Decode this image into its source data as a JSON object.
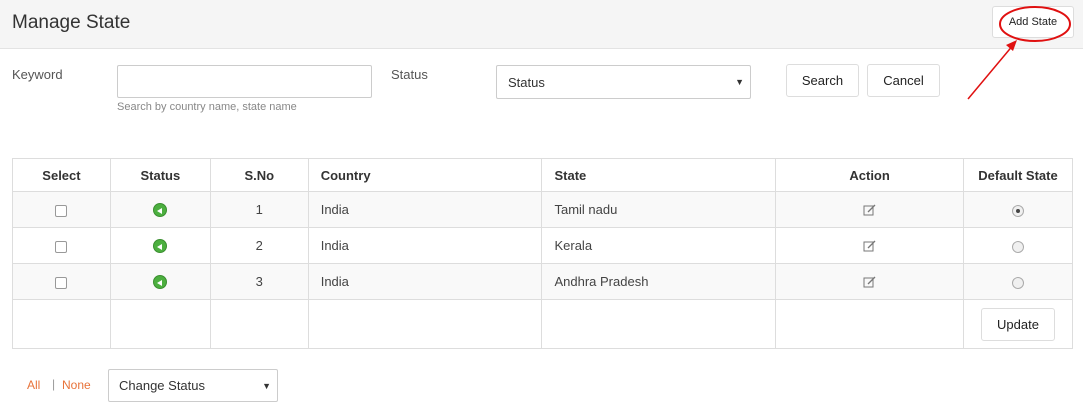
{
  "header": {
    "title": "Manage State",
    "add_button": "Add State"
  },
  "filters": {
    "keyword_label": "Keyword",
    "keyword_value": "",
    "keyword_hint": "Search by country name, state name",
    "status_label": "Status",
    "status_selected": "Status",
    "search_button": "Search",
    "cancel_button": "Cancel"
  },
  "table": {
    "headers": [
      "Select",
      "Status",
      "S.No",
      "Country",
      "State",
      "Action",
      "Default State"
    ],
    "rows": [
      {
        "sno": "1",
        "country": "India",
        "state": "Tamil nadu",
        "default": true
      },
      {
        "sno": "2",
        "country": "India",
        "state": "Kerala",
        "default": false
      },
      {
        "sno": "3",
        "country": "India",
        "state": "Andhra Pradesh",
        "default": false
      }
    ],
    "update_button": "Update"
  },
  "bottom": {
    "all_link": "All",
    "separator": "|",
    "none_link": "None",
    "change_status": "Change Status"
  },
  "colors": {
    "annotation": "#e01010",
    "status_active": "#4caf3f",
    "link": "#e8733a"
  },
  "icons": {
    "status": "active-status-icon",
    "action": "edit-icon"
  }
}
